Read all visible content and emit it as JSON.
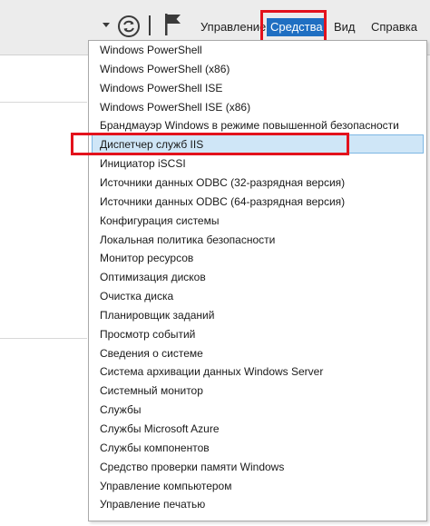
{
  "menubar": {
    "items": [
      "Управление",
      "Средства",
      "Вид",
      "Справка"
    ],
    "active_index": 1
  },
  "icons": {
    "dropdown": "caret-down-icon",
    "refresh": "refresh-icon",
    "notifications": "flag-icon"
  },
  "tools_menu": {
    "items": [
      "Windows PowerShell",
      "Windows PowerShell (x86)",
      "Windows PowerShell ISE",
      "Windows PowerShell ISE (x86)",
      "Брандмауэр Windows в режиме повышенной безопасности",
      "Диспетчер служб IIS",
      "Инициатор iSCSI",
      "Источники данных ODBC (32-разрядная версия)",
      "Источники данных ODBC (64-разрядная версия)",
      "Конфигурация системы",
      "Локальная политика безопасности",
      "Монитор ресурсов",
      "Оптимизация дисков",
      "Очистка диска",
      "Планировщик заданий",
      "Просмотр событий",
      "Сведения о системе",
      "Система архивации данных Windows Server",
      "Системный монитор",
      "Службы",
      "Службы Microsoft Azure",
      "Службы компонентов",
      "Средство проверки памяти Windows",
      "Управление компьютером",
      "Управление печатью"
    ],
    "selected_index": 5
  },
  "colors": {
    "accent": "#1f6fc2",
    "highlight_border": "#e3121c",
    "selected_row": "#cfe6f7"
  }
}
